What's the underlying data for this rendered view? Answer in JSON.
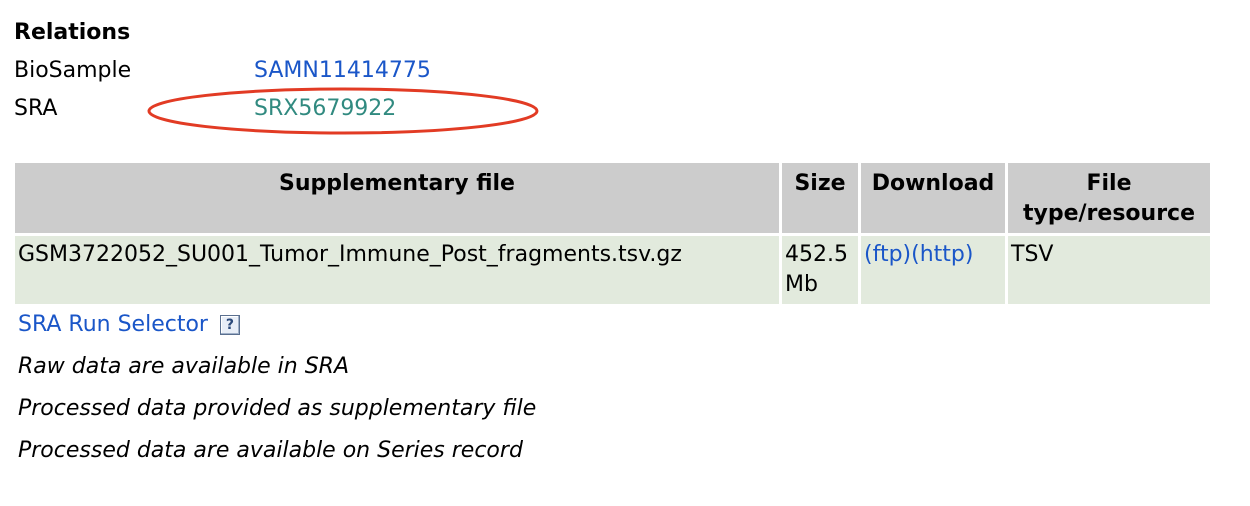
{
  "relations": {
    "title": "Relations",
    "rows": [
      {
        "label": "BioSample",
        "value": "SAMN11414775"
      },
      {
        "label": "SRA",
        "value": "SRX5679922"
      }
    ]
  },
  "annotation": {
    "shape": "ellipse",
    "color": "#e23b24"
  },
  "colors": {
    "link": "#1a56c8",
    "visited_link": "#318a80",
    "header_bg": "#cccccc",
    "row_bg": "#e2eadd"
  },
  "table": {
    "headers": {
      "file": "Supplementary file",
      "size": "Size",
      "download": "Download",
      "type_line1": "File",
      "type_line2": "type/resource"
    },
    "rows": [
      {
        "file": "GSM3722052_SU001_Tumor_Immune_Post_fragments.tsv.gz",
        "size_line1": "452.5",
        "size_line2": "Mb",
        "ftp": "(ftp)",
        "http": "(http)",
        "type": "TSV"
      }
    ]
  },
  "sra_run_selector": {
    "label": "SRA Run Selector",
    "help_icon": "help-icon"
  },
  "notes": [
    "Raw data are available in SRA",
    "Processed data provided as supplementary file",
    "Processed data are available on Series record"
  ]
}
